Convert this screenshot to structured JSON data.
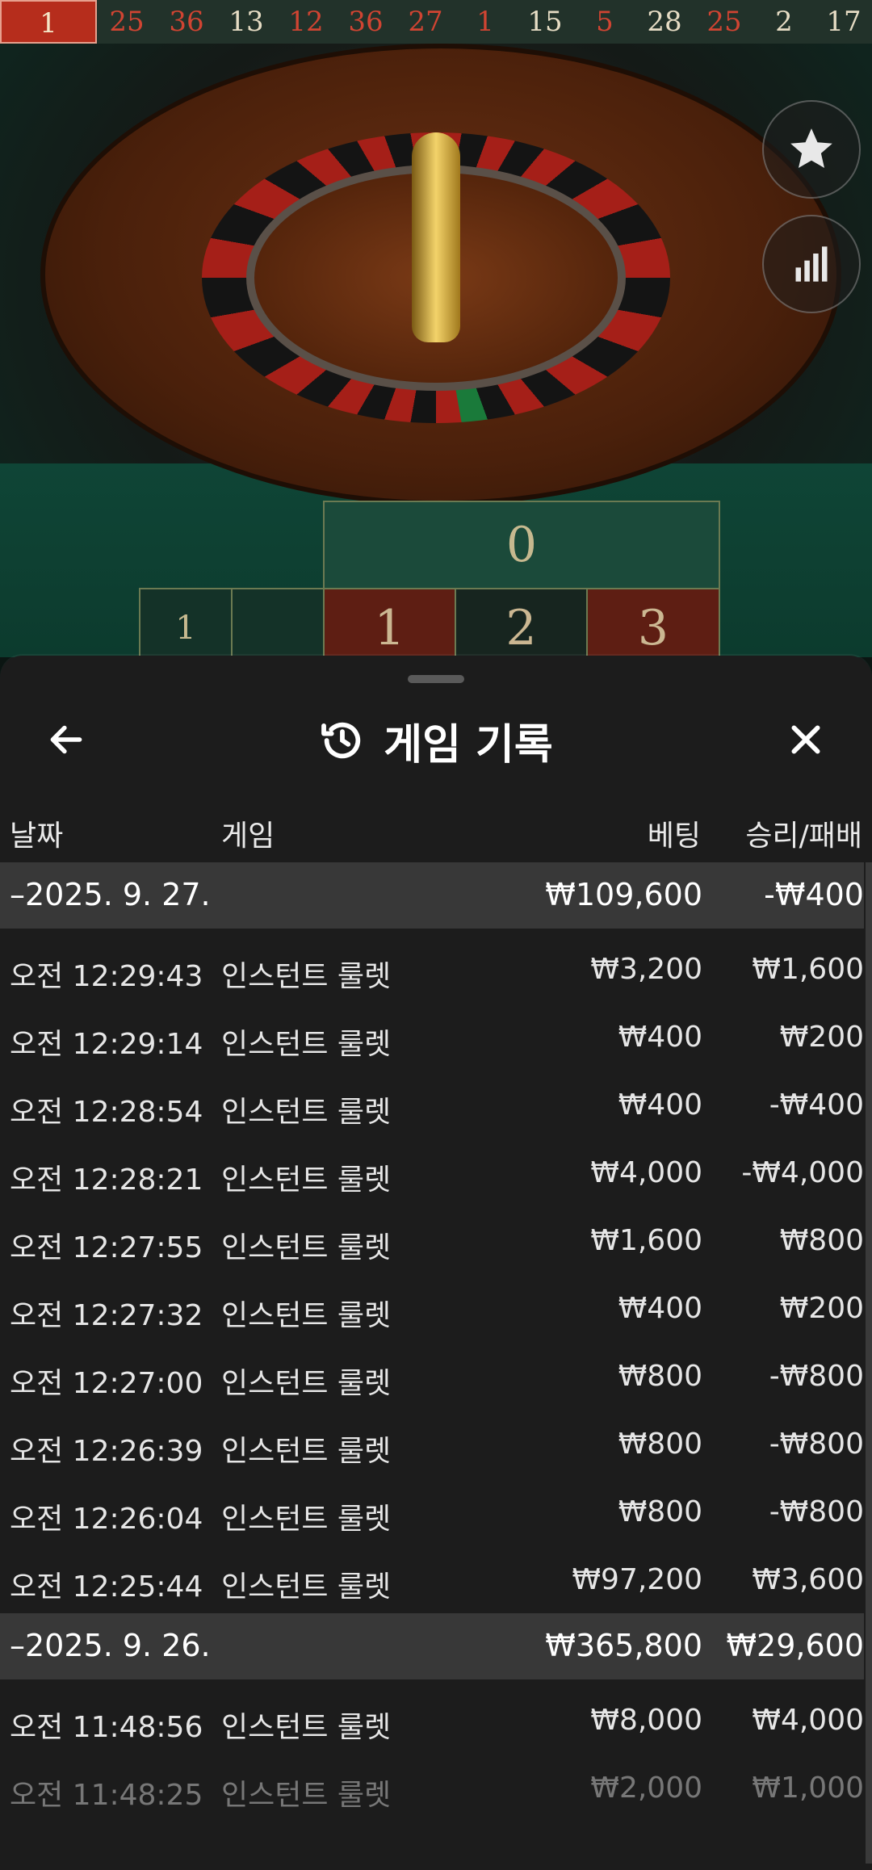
{
  "results_strip": [
    {
      "n": "1",
      "c": "red"
    },
    {
      "n": "25",
      "c": "red"
    },
    {
      "n": "36",
      "c": "red"
    },
    {
      "n": "13",
      "c": "black"
    },
    {
      "n": "12",
      "c": "red"
    },
    {
      "n": "36",
      "c": "red"
    },
    {
      "n": "27",
      "c": "red"
    },
    {
      "n": "1",
      "c": "red"
    },
    {
      "n": "15",
      "c": "black"
    },
    {
      "n": "5",
      "c": "red"
    },
    {
      "n": "28",
      "c": "black"
    },
    {
      "n": "25",
      "c": "red"
    },
    {
      "n": "2",
      "c": "black"
    },
    {
      "n": "17",
      "c": "black"
    }
  ],
  "table": {
    "zero": "0",
    "n1": "1",
    "n2": "2",
    "n3": "3",
    "side": "1"
  },
  "sheet": {
    "title": "게임 기록",
    "columns": {
      "date": "날짜",
      "game": "게임",
      "bet": "베팅",
      "result": "승리/패배"
    },
    "groups": [
      {
        "date": "–2025. 9. 27.",
        "bet_total": "₩109,600",
        "result_total": "-₩400",
        "rows": [
          {
            "time": "오전 12:29:43",
            "game": "인스턴트 룰렛",
            "bet": "₩3,200",
            "result": "₩1,600"
          },
          {
            "time": "오전 12:29:14",
            "game": "인스턴트 룰렛",
            "bet": "₩400",
            "result": "₩200"
          },
          {
            "time": "오전 12:28:54",
            "game": "인스턴트 룰렛",
            "bet": "₩400",
            "result": "-₩400"
          },
          {
            "time": "오전 12:28:21",
            "game": "인스턴트 룰렛",
            "bet": "₩4,000",
            "result": "-₩4,000"
          },
          {
            "time": "오전 12:27:55",
            "game": "인스턴트 룰렛",
            "bet": "₩1,600",
            "result": "₩800"
          },
          {
            "time": "오전 12:27:32",
            "game": "인스턴트 룰렛",
            "bet": "₩400",
            "result": "₩200"
          },
          {
            "time": "오전 12:27:00",
            "game": "인스턴트 룰렛",
            "bet": "₩800",
            "result": "-₩800"
          },
          {
            "time": "오전 12:26:39",
            "game": "인스턴트 룰렛",
            "bet": "₩800",
            "result": "-₩800"
          },
          {
            "time": "오전 12:26:04",
            "game": "인스턴트 룰렛",
            "bet": "₩800",
            "result": "-₩800"
          },
          {
            "time": "오전 12:25:44",
            "game": "인스턴트 룰렛",
            "bet": "₩97,200",
            "result": "₩3,600"
          }
        ]
      },
      {
        "date": "–2025. 9. 26.",
        "bet_total": "₩365,800",
        "result_total": "₩29,600",
        "rows": [
          {
            "time": "오전 11:48:56",
            "game": "인스턴트 룰렛",
            "bet": "₩8,000",
            "result": "₩4,000"
          },
          {
            "time": "오전 11:48:25",
            "game": "인스턴트 룰렛",
            "bet": "₩2,000",
            "result": "₩1,000"
          }
        ]
      }
    ]
  },
  "colors": {
    "red": "#d04432",
    "black": "#e6dcc4",
    "sheet_bg": "#1c1c1c",
    "group_bg": "#383838"
  }
}
